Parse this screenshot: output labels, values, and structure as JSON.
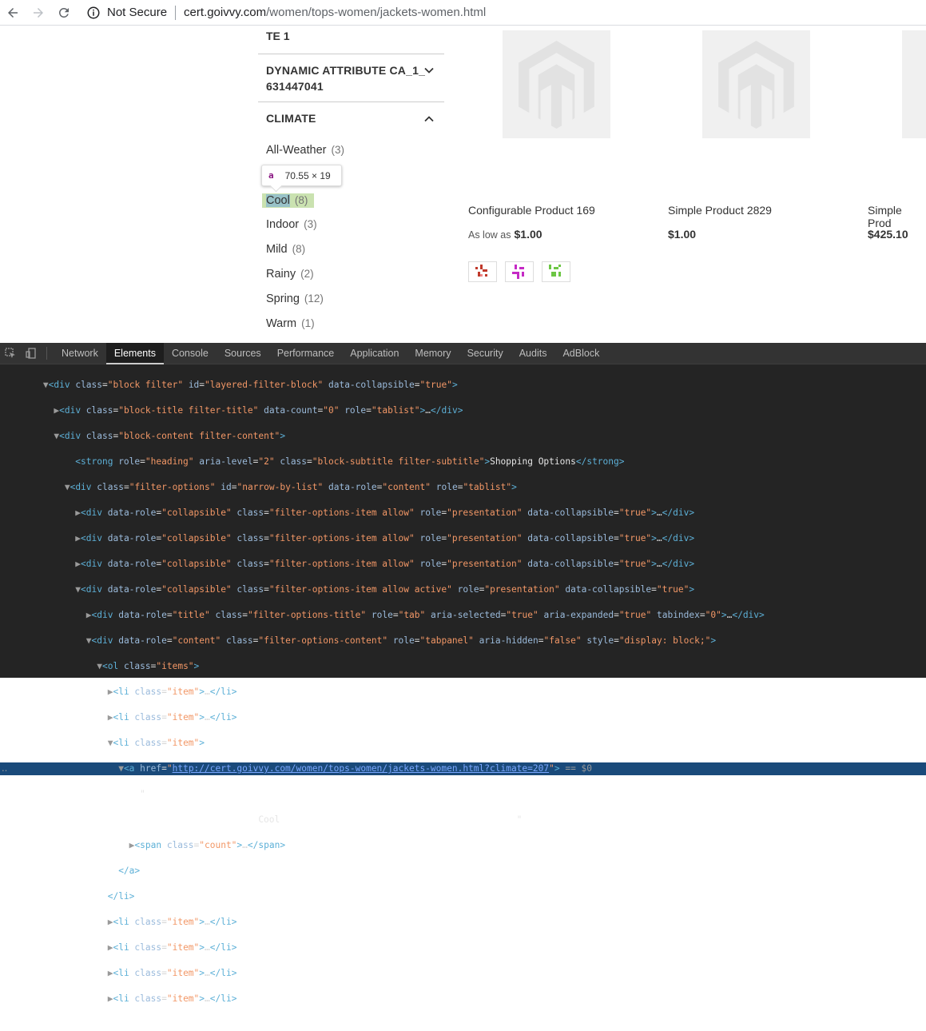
{
  "browser": {
    "security_label": "Not Secure",
    "url_host": "cert.goivvy.com",
    "url_path": "/women/tops-women/jackets-women.html"
  },
  "sidebar": {
    "top_title_fragment": "TE 1",
    "dynamic_attr_line1": "DYNAMIC ATTRIBUTE CA_1_",
    "dynamic_attr_line2": "631447041",
    "climate_title": "CLIMATE",
    "options": [
      {
        "label": "All-Weather",
        "count": "(3)"
      },
      {
        "label": "Cool",
        "count": "(8)"
      },
      {
        "label": "Indoor",
        "count": "(3)"
      },
      {
        "label": "Mild",
        "count": "(8)"
      },
      {
        "label": "Rainy",
        "count": "(2)"
      },
      {
        "label": "Spring",
        "count": "(12)"
      },
      {
        "label": "Warm",
        "count": "(1)"
      }
    ]
  },
  "inspect_tooltip": {
    "tag": "a",
    "size": "70.55 × 19"
  },
  "products": [
    {
      "name": "Configurable Product 169",
      "price_prefix": "As low as",
      "price": "$1.00"
    },
    {
      "name": "Simple Product 2829",
      "price_prefix": "",
      "price": "$1.00"
    },
    {
      "name": "Simple Prod",
      "price_prefix": "",
      "price": "$425.10"
    }
  ],
  "swatch_colors": [
    "#c0392b",
    "#c52ac5",
    "#6cc644"
  ],
  "devtools": {
    "tabs": [
      "Network",
      "Elements",
      "Console",
      "Sources",
      "Performance",
      "Application",
      "Memory",
      "Security",
      "Audits",
      "AdBlock"
    ],
    "active_tab": "Elements",
    "lines": {
      "l1_tag": "<div",
      "l1_a1": "class",
      "l1_v1": "\"block filter\"",
      "l1_a2": "id",
      "l1_v2": "\"layered-filter-block\"",
      "l1_a3": "data-collapsible",
      "l1_v3": "\"true\"",
      "l2_a1": "class",
      "l2_v1": "\"block-title filter-title\"",
      "l2_a2": "data-count",
      "l2_v2": "\"0\"",
      "l2_a3": "role",
      "l2_v3": "\"tablist\"",
      "l3_v1": "\"block-content filter-content\"",
      "l4_strong_role": "\"heading\"",
      "l4_level": "\"2\"",
      "l4_class": "\"block-subtitle filter-subtitle\"",
      "l4_text": "Shopping Options",
      "l5_class": "\"filter-options\"",
      "l5_id": "\"narrow-by-list\"",
      "l5_role": "\"content\"",
      "l5_tab": "\"tablist\"",
      "collapsible_class": "\"filter-options-item allow\"",
      "collapsible_active_class": "\"filter-options-item allow active\"",
      "title_class": "\"filter-options-title\"",
      "content_class": "\"filter-options-content\"",
      "content_style": "\"display: block;\"",
      "ol_class": "\"items\"",
      "li_class": "\"item\"",
      "href": "http://cert.goivvy.com/women/tops-women/jackets-women.html?climate=207",
      "dollar0": "== $0",
      "text_cool": "Cool",
      "span_class": "\"count\""
    }
  }
}
